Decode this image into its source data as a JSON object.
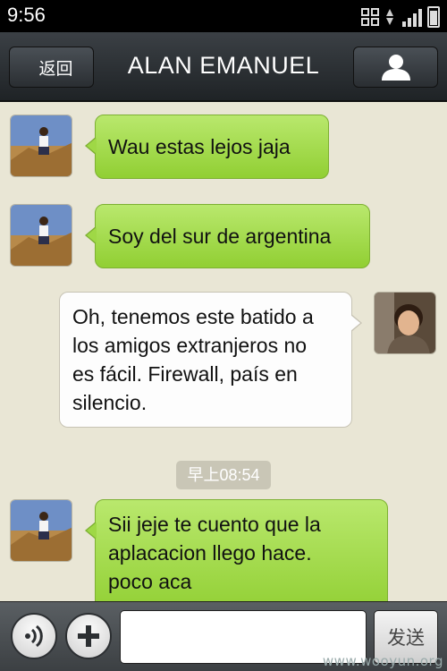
{
  "status_bar": {
    "time": "9:56",
    "icons": [
      "grid-icon",
      "data-transfer-icon",
      "signal-icon",
      "battery-icon"
    ]
  },
  "nav": {
    "back_label": "返回",
    "title": "ALAN EMANUEL",
    "profile_icon": "person-icon"
  },
  "messages": [
    {
      "side": "left",
      "color": "green",
      "text": "Wau estas lejos jaja"
    },
    {
      "side": "left",
      "color": "green",
      "text": "Soy del sur de argentina"
    },
    {
      "side": "right",
      "color": "white",
      "lines": [
        "Oh, tenemos este batido a",
        "los amigos extranjeros no",
        "es fácil. Firewall, país en",
        "silencio."
      ]
    },
    {
      "side": "left",
      "color": "green",
      "lines": [
        "Sii jeje te cuento que la",
        "aplacacion llego hace.",
        "poco aca"
      ]
    }
  ],
  "timestamp": "早上08:54",
  "input_bar": {
    "voice_icon": "voice-icon",
    "plus_icon": "plus-icon",
    "input_value": "",
    "send_label": "发送"
  },
  "watermark": "www.wooyun.org",
  "colors": {
    "bubble_green": "#a2dc4a",
    "bubble_white": "#fdfdfd",
    "chat_background": "#e9e6d5",
    "nav_background": "#2e3236"
  }
}
